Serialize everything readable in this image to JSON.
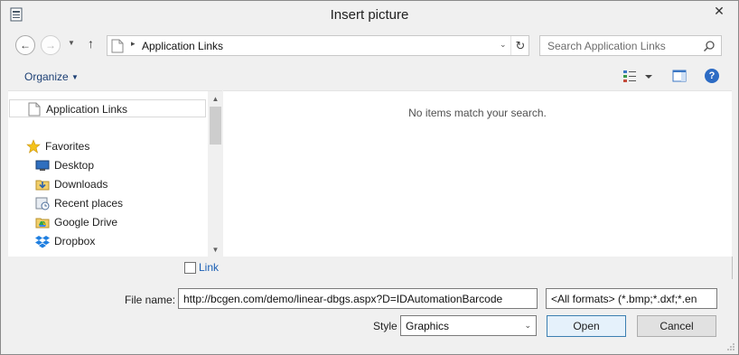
{
  "window": {
    "title": "Insert picture",
    "close_glyph": "✕"
  },
  "nav": {
    "back_icon": "back-arrow-icon",
    "forward_icon": "forward-arrow-icon",
    "up_icon": "up-arrow-icon",
    "address": {
      "path": "Application Links",
      "separator": "▸"
    },
    "search": {
      "placeholder": "Search Application Links"
    }
  },
  "toolbar": {
    "organize_label": "Organize",
    "organize_caret": "▼"
  },
  "sidebar": {
    "items": [
      {
        "label": "Application Links",
        "icon": "page-icon"
      },
      {
        "label": "Favorites",
        "icon": "star-icon"
      },
      {
        "label": "Desktop",
        "icon": "desktop-icon"
      },
      {
        "label": "Downloads",
        "icon": "downloads-icon"
      },
      {
        "label": "Recent places",
        "icon": "recent-places-icon"
      },
      {
        "label": "Google Drive",
        "icon": "google-drive-icon"
      },
      {
        "label": "Dropbox",
        "icon": "dropbox-icon"
      }
    ]
  },
  "main": {
    "empty_message": "No items match your search."
  },
  "bottom": {
    "link_label": "Link",
    "link_checked": false,
    "file_name_label": "File name:",
    "file_name_value": "http://bcgen.com/demo/linear-dbgs.aspx?D=IDAutomationBarcode",
    "format_value": "<All formats> (*.bmp;*.dxf;*.en",
    "style_label": "Style",
    "style_value": "Graphics",
    "open_label": "Open",
    "cancel_label": "Cancel"
  },
  "colors": {
    "link": "#1a5fb4",
    "help": "#2c6bc4",
    "organize": "#1c3f74"
  }
}
